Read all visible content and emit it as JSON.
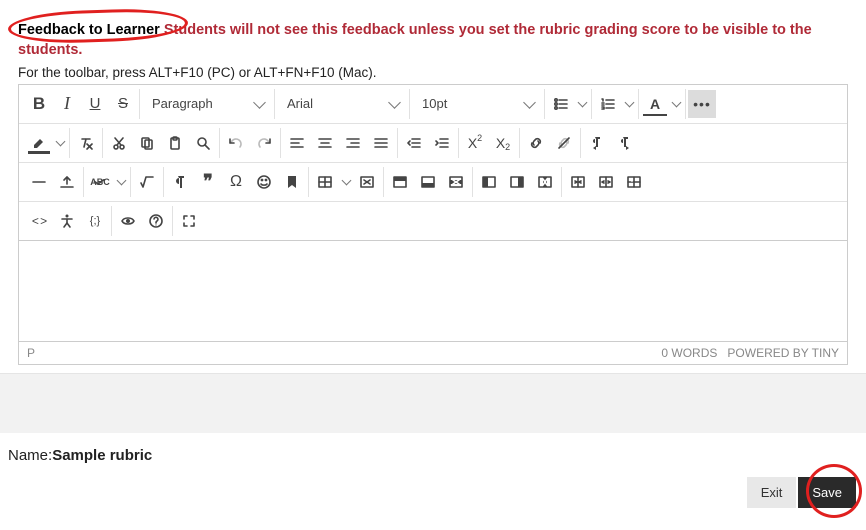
{
  "header": {
    "label_strong": "Feedback to Learner",
    "warning_rest": " Students will not see this feedback unless you set the rubric grading score to be visible to the students."
  },
  "hint_text": "For the toolbar, press ALT+F10 (PC) or ALT+FN+F10 (Mac).",
  "toolbar": {
    "bold": "B",
    "para_sel": "Paragraph",
    "font_sel": "Arial",
    "size_sel": "10pt",
    "textcolor_letter": "A",
    "more": "•••",
    "sup_x": "X",
    "sub_x": "X",
    "quote": "❞",
    "omega": "Ω",
    "bookmark_fill": "▮",
    "code": "< >",
    "braces": "{;}"
  },
  "statusbar": {
    "path": "P",
    "words": "0 WORDS",
    "powered": "POWERED BY TINY"
  },
  "rubric": {
    "name_label": "Name:",
    "name_value": "Sample rubric"
  },
  "buttons": {
    "exit": "Exit",
    "save": "Save"
  }
}
